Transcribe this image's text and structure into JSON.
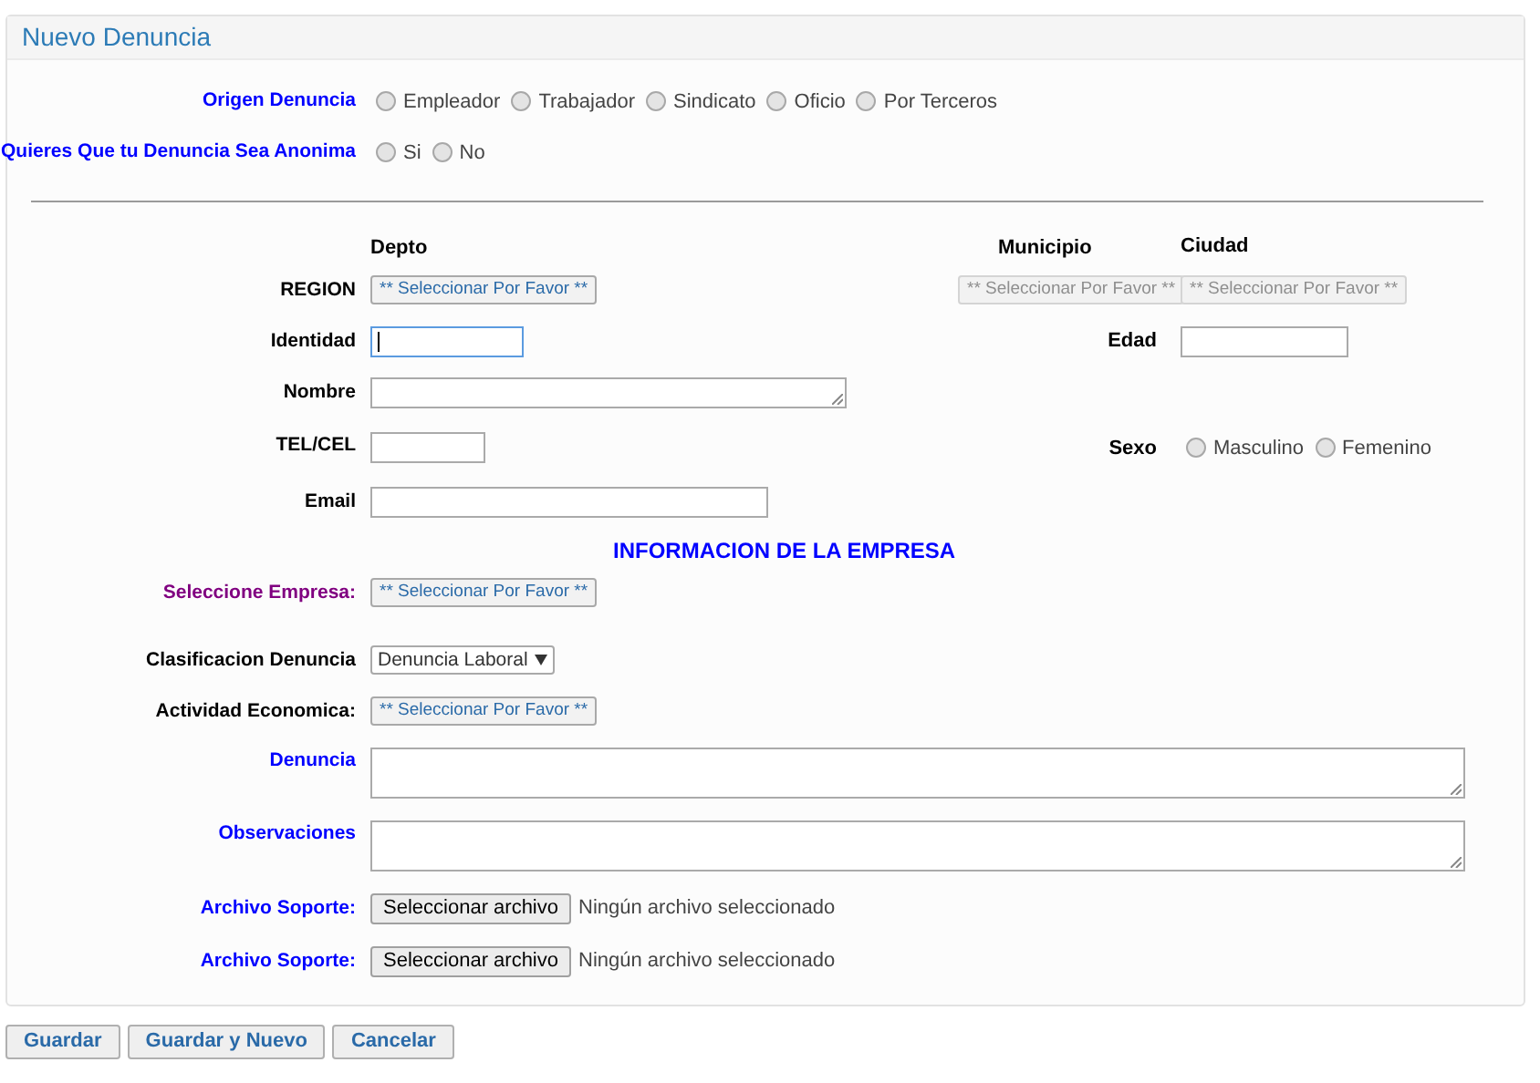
{
  "panel_title": "Nuevo Denuncia",
  "origen": {
    "label": "Origen Denuncia",
    "options": [
      {
        "label": "Empleador",
        "selected": false
      },
      {
        "label": "Trabajador",
        "selected": false
      },
      {
        "label": "Sindicato",
        "selected": false
      },
      {
        "label": "Oficio",
        "selected": false
      },
      {
        "label": "Por Terceros",
        "selected": false
      }
    ]
  },
  "anonima": {
    "label": "Quieres Que tu Denuncia Sea Anonima",
    "options": [
      {
        "label": "Si",
        "selected": false
      },
      {
        "label": "No",
        "selected": false
      }
    ]
  },
  "location": {
    "headers": [
      "Depto",
      "Municipio",
      "Ciudad"
    ],
    "label": "REGION",
    "selects": [
      {
        "text": "** Seleccionar Por Favor **",
        "disabled": false
      },
      {
        "text": "** Seleccionar Por Favor **",
        "disabled": true
      },
      {
        "text": "** Seleccionar Por Favor **",
        "disabled": true
      }
    ]
  },
  "identidad": {
    "label": "Identidad",
    "focused": true
  },
  "edad": {
    "label": "Edad",
    "focused": false
  },
  "nombre": {
    "label": "Nombre"
  },
  "tel": {
    "label": "TEL/CEL",
    "focused": false
  },
  "sexo": {
    "label": "Sexo",
    "options": [
      {
        "label": "Masculino",
        "selected": false
      },
      {
        "label": "Femenino",
        "selected": false
      }
    ]
  },
  "email": {
    "label": "Email",
    "focused": false
  },
  "empresa": {
    "title": "INFORMACION DE LA EMPRESA",
    "rows": [
      {
        "kind": "picker",
        "label": "Seleccione Empresa:",
        "color": "#800080",
        "value": "** Seleccionar Por Favor **"
      },
      {
        "kind": "dropdown",
        "label": "Clasificacion Denuncia",
        "color": "#000000",
        "value": "Denuncia Laboral"
      },
      {
        "kind": "picker",
        "label": "Actividad Economica:",
        "color": "#000000",
        "value": "** Seleccionar Por Favor **"
      },
      {
        "kind": "textarea",
        "label": "Denuncia",
        "color": "#0000ff"
      },
      {
        "kind": "textarea",
        "label": "Observaciones",
        "color": "#0000ff"
      },
      {
        "kind": "file",
        "label": "Archivo Soporte:",
        "color": "#0000ff",
        "button": "Seleccionar archivo",
        "status": "Ningún archivo seleccionado"
      },
      {
        "kind": "file",
        "label": "Archivo Soporte:",
        "color": "#0000ff",
        "button": "Seleccionar archivo",
        "status": "Ningún archivo seleccionado"
      }
    ]
  },
  "buttons": [
    "Guardar",
    "Guardar y Nuevo",
    "Cancelar"
  ]
}
